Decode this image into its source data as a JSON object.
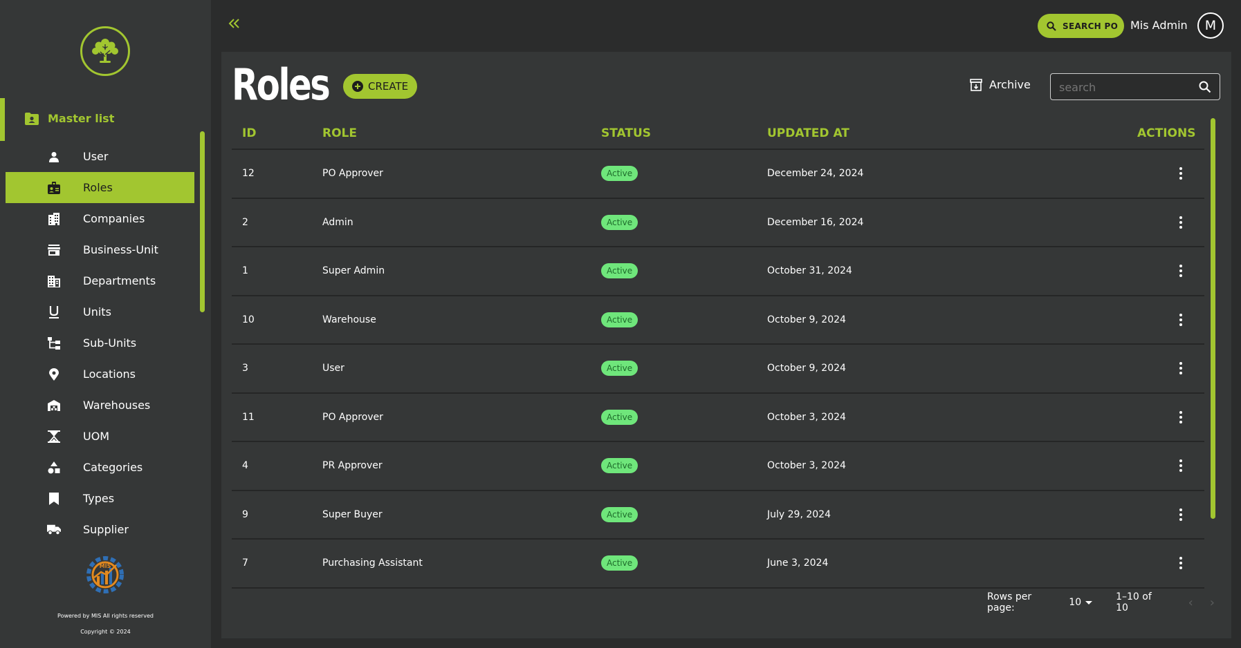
{
  "brand": {
    "accent": "#a2c630",
    "sidebar_bg": "#353737",
    "page_bg": "#2b2c2c",
    "badge_bg": "#6fe67b"
  },
  "sidebar": {
    "section_label": "Master list",
    "items": [
      {
        "label": "User",
        "icon": "user-icon",
        "active": false
      },
      {
        "label": "Roles",
        "icon": "id-badge-icon",
        "active": true
      },
      {
        "label": "Companies",
        "icon": "building-icon",
        "active": false
      },
      {
        "label": "Business-Unit",
        "icon": "store-icon",
        "active": false
      },
      {
        "label": "Departments",
        "icon": "department-icon",
        "active": false
      },
      {
        "label": "Units",
        "icon": "unit-u-icon",
        "active": false
      },
      {
        "label": "Sub-Units",
        "icon": "tree-structure-icon",
        "active": false
      },
      {
        "label": "Locations",
        "icon": "location-pin-icon",
        "active": false
      },
      {
        "label": "Warehouses",
        "icon": "warehouse-icon",
        "active": false
      },
      {
        "label": "UOM",
        "icon": "hourglass-icon",
        "active": false
      },
      {
        "label": "Categories",
        "icon": "categories-shapes-icon",
        "active": false
      },
      {
        "label": "Types",
        "icon": "bookmark-icon",
        "active": false
      },
      {
        "label": "Supplier",
        "icon": "truck-icon",
        "active": false
      }
    ],
    "footer_powered": "Powered by MIS All rights reserved",
    "footer_copyright": "Copyright © 2024"
  },
  "topbar": {
    "search_po_label": "SEARCH PO",
    "user_name": "Mis Admin",
    "avatar_letter": "M"
  },
  "main": {
    "title": "Roles",
    "create_label": "CREATE",
    "archive_label": "Archive",
    "search_placeholder": "search",
    "columns": {
      "id": "ID",
      "role": "ROLE",
      "status": "STATUS",
      "updated_at": "UPDATED AT",
      "actions": "ACTIONS"
    },
    "rows": [
      {
        "id": "12",
        "role": "PO Approver",
        "status": "Active",
        "updated_at": "December 24, 2024"
      },
      {
        "id": "2",
        "role": "Admin",
        "status": "Active",
        "updated_at": "December 16, 2024"
      },
      {
        "id": "1",
        "role": "Super Admin",
        "status": "Active",
        "updated_at": "October 31, 2024"
      },
      {
        "id": "10",
        "role": "Warehouse",
        "status": "Active",
        "updated_at": "October 9, 2024"
      },
      {
        "id": "3",
        "role": "User",
        "status": "Active",
        "updated_at": "October 9, 2024"
      },
      {
        "id": "11",
        "role": "PO Approver",
        "status": "Active",
        "updated_at": "October 3, 2024"
      },
      {
        "id": "4",
        "role": "PR Approver",
        "status": "Active",
        "updated_at": "October 3, 2024"
      },
      {
        "id": "9",
        "role": "Super Buyer",
        "status": "Active",
        "updated_at": "July 29, 2024"
      },
      {
        "id": "7",
        "role": "Purchasing Assistant",
        "status": "Active",
        "updated_at": "June 3, 2024"
      }
    ],
    "pagination": {
      "rows_per_page_label": "Rows per page:",
      "rows_per_page_value": "10",
      "range": "1–10 of 10"
    }
  }
}
